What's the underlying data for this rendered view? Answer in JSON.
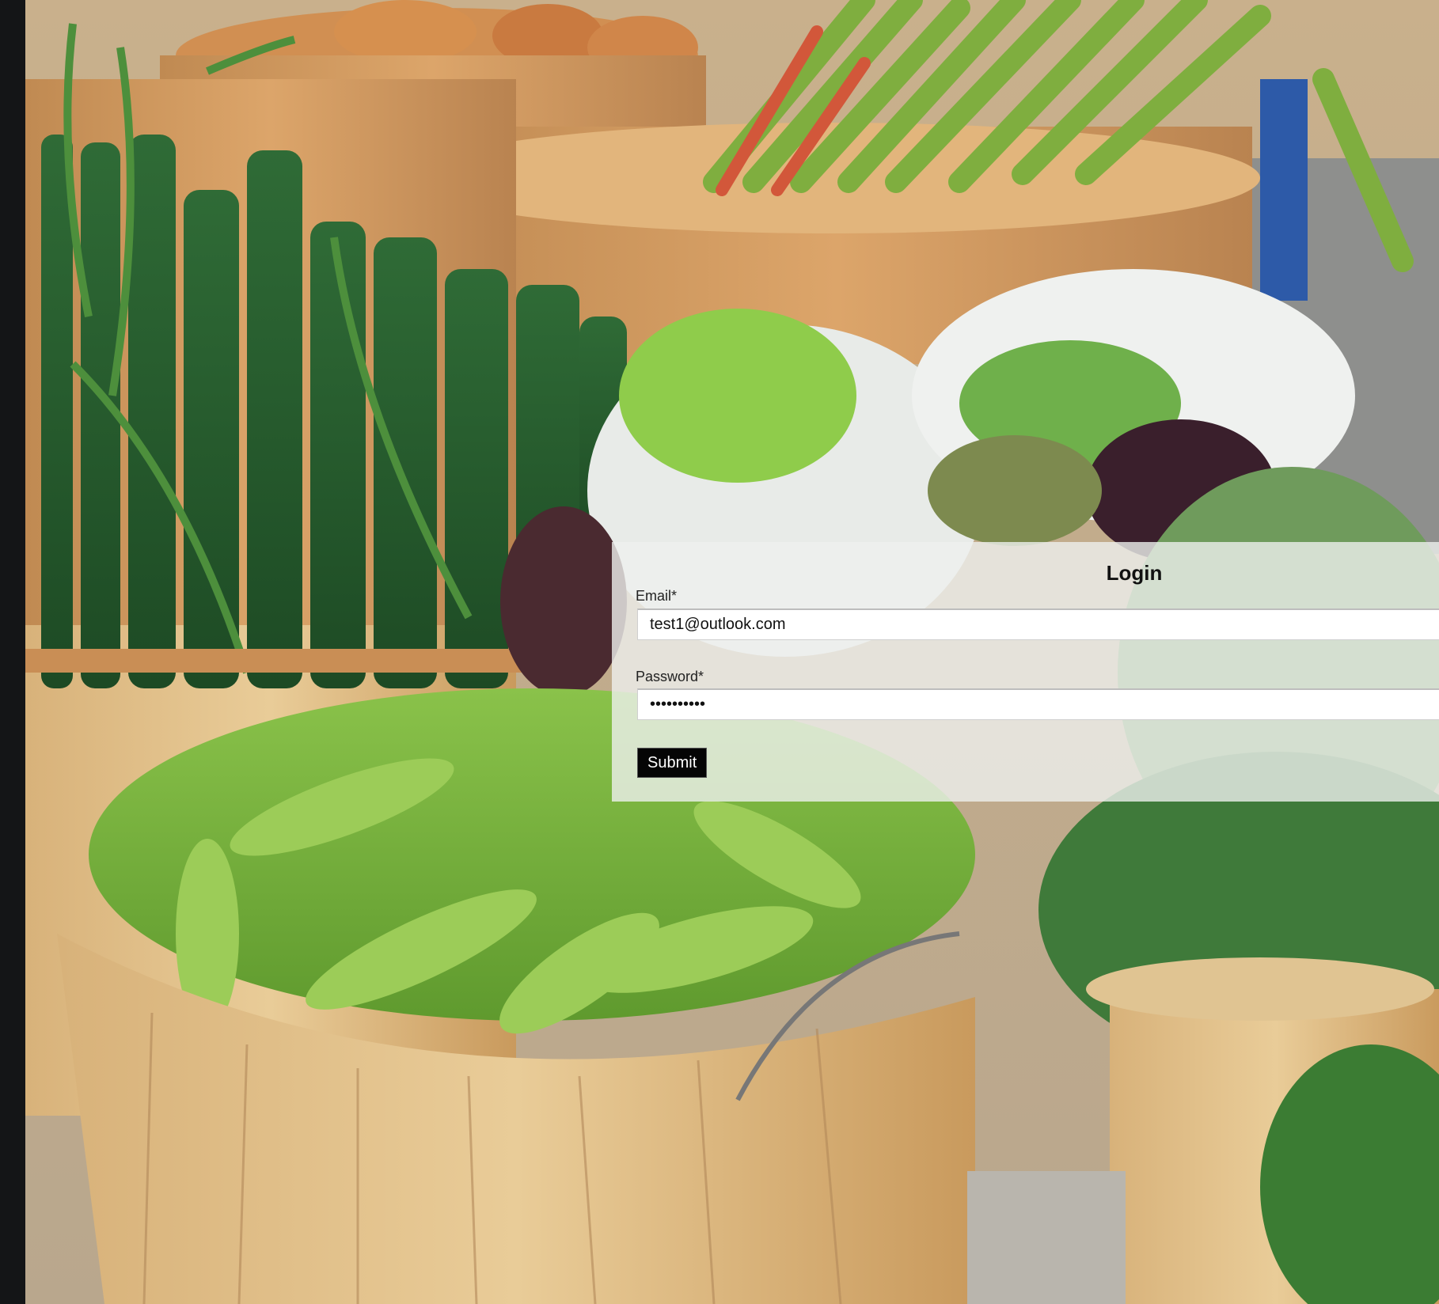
{
  "background": {
    "description_icon": "vegetable-market-photo"
  },
  "login": {
    "title": "Login",
    "email_label": "Email*",
    "email_value": "test1@outlook.com",
    "password_label": "Password*",
    "password_value": "••••••••••",
    "submit_label": "Submit"
  },
  "colors": {
    "panel_bg": "#eef0ee",
    "button_bg": "#050505",
    "button_text": "#ffffff"
  }
}
